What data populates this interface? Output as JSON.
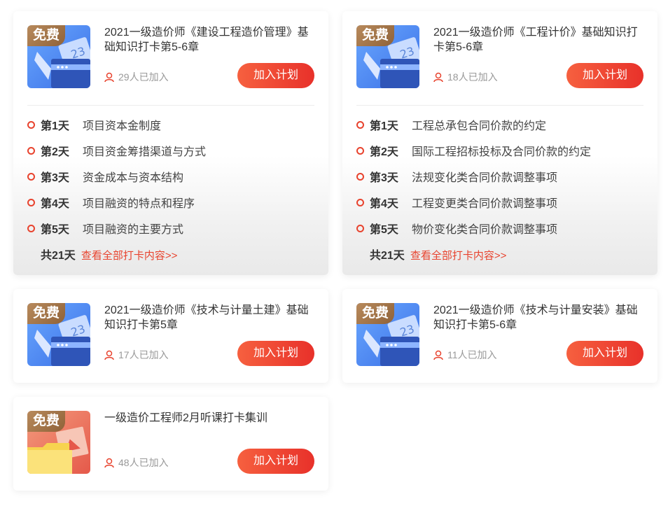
{
  "free_tag": "免费",
  "join_label": "加入计划",
  "cards": [
    {
      "title": "2021一级造价师《建设工程造价管理》基础知识打卡第5-6章",
      "joined": "29人已加入",
      "days": [
        {
          "label": "第1天",
          "topic": "项目资本金制度"
        },
        {
          "label": "第2天",
          "topic": "项目资金筹措渠道与方式"
        },
        {
          "label": "第3天",
          "topic": "资金成本与资本结构"
        },
        {
          "label": "第4天",
          "topic": "项目融资的特点和程序"
        },
        {
          "label": "第5天",
          "topic": "项目融资的主要方式"
        }
      ],
      "total": "共21天",
      "view_all": "查看全部打卡内容>>"
    },
    {
      "title": "2021一级造价师《工程计价》基础知识打卡第5-6章",
      "joined": "18人已加入",
      "days": [
        {
          "label": "第1天",
          "topic": "工程总承包合同价款的约定"
        },
        {
          "label": "第2天",
          "topic": "国际工程招标投标及合同价款的约定"
        },
        {
          "label": "第3天",
          "topic": "法规变化类合同价款调整事项"
        },
        {
          "label": "第4天",
          "topic": "工程变更类合同价款调整事项"
        },
        {
          "label": "第5天",
          "topic": "物价变化类合同价款调整事项"
        }
      ],
      "total": "共21天",
      "view_all": "查看全部打卡内容>>"
    },
    {
      "title": "2021一级造价师《技术与计量土建》基础知识打卡第5章",
      "joined": "17人已加入"
    },
    {
      "title": "2021一级造价师《技术与计量安装》基础知识打卡第5-6章",
      "joined": "11人已加入"
    },
    {
      "title": "一级造价工程师2月听课打卡集训",
      "joined": "48人已加入"
    }
  ]
}
